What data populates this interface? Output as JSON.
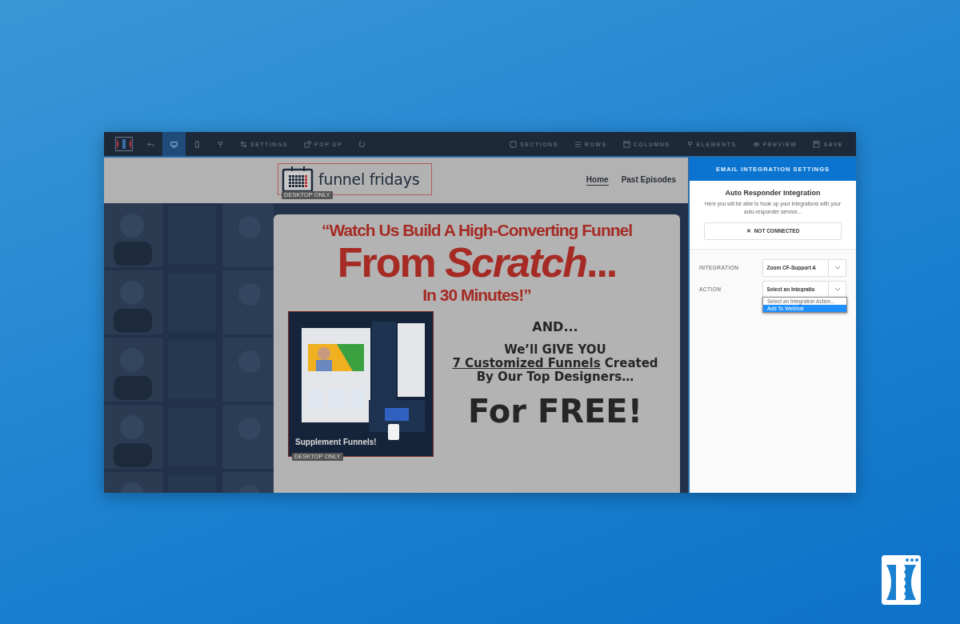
{
  "toolbar": {
    "device_toggle": [
      {
        "selected": true
      },
      {
        "selected": false
      }
    ],
    "left_buttons": [
      "SETTINGS",
      "POP UP"
    ],
    "right_buttons": [
      "SECTIONS",
      "ROWS",
      "COLUMNS",
      "ELEMENTS",
      "PREVIEW",
      "SAVE"
    ]
  },
  "page": {
    "logo_text": "funnel fridays",
    "logo_badge": "DESKTOP ONLY",
    "nav": [
      {
        "label": "Home",
        "selected": true
      },
      {
        "label": "Past Episodes",
        "selected": false
      }
    ],
    "headline": [
      "“Watch Us Build A High-Converting Funnel",
      "From *Scratch*...",
      "In 30 Minutes!”"
    ],
    "image_caption": "Supplement Funnels!",
    "image_badge": "DESKTOP ONLY",
    "and": "AND...",
    "give": "We’ll GIVE YOU",
    "offer_underlined": "7 Customized Funnels",
    "offer_rest": " Created By Our Top Designers…",
    "free": "For FREE!"
  },
  "panel": {
    "title": "EMAIL INTEGRATION SETTINGS",
    "heading": "Auto Responder Integration",
    "description": "Here you will be able to hook up your integrations with your auto-responder service...",
    "connect_button": {
      "icon": "✕",
      "label": "NOT CONNECTED"
    },
    "fields": [
      {
        "label": "INTEGRATION",
        "value": "Zoom CF-Support A"
      },
      {
        "label": "ACTION",
        "value": "Select an Integratio"
      }
    ],
    "dropdown_options": [
      {
        "label": "Select an Integration Action...",
        "selected": false
      },
      {
        "label": "Add To Webinar",
        "selected": true
      }
    ]
  }
}
